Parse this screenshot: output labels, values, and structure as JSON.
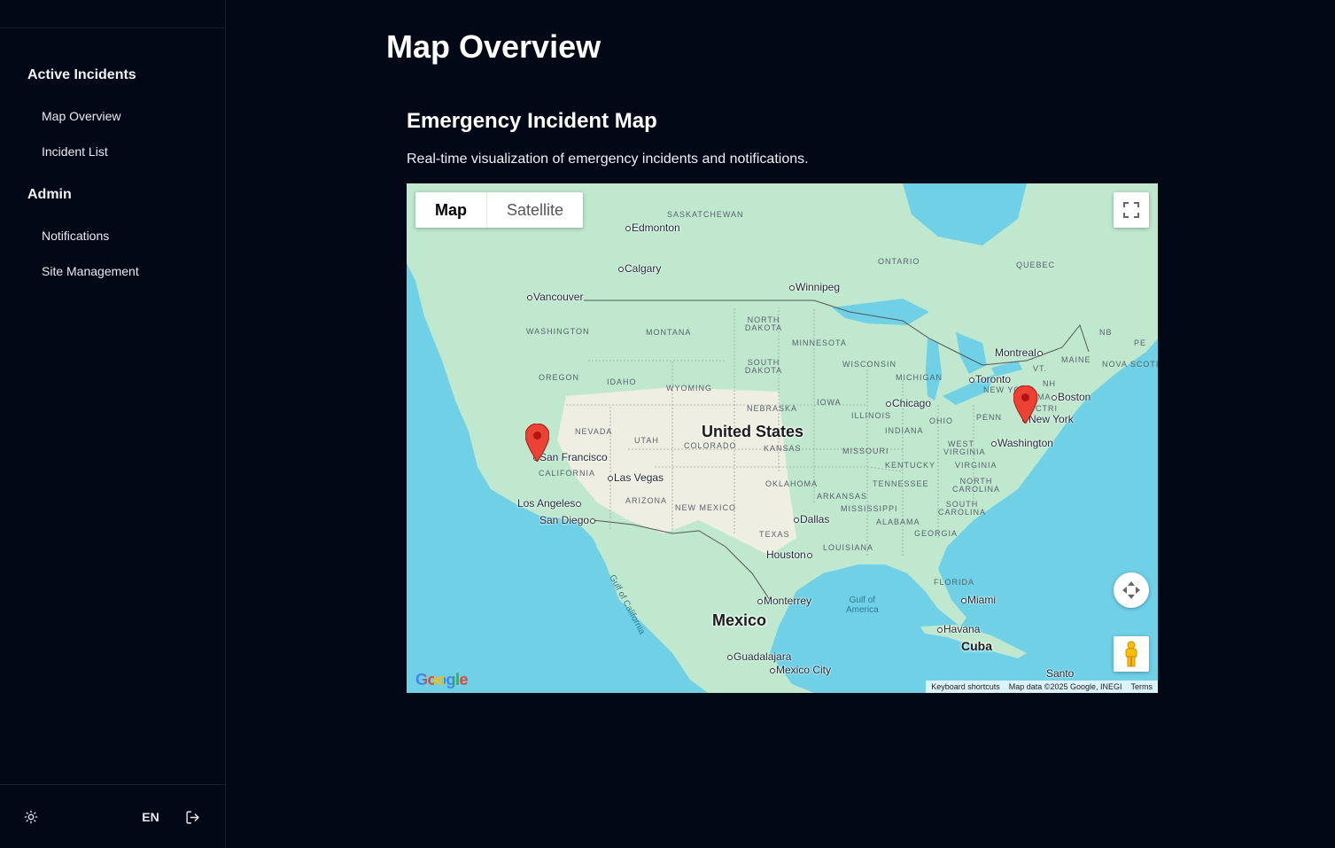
{
  "sidebar": {
    "groups": [
      {
        "title": "Active Incidents",
        "items": [
          "Map Overview",
          "Incident List"
        ]
      },
      {
        "title": "Admin",
        "items": [
          "Notifications",
          "Site Management"
        ]
      }
    ],
    "footer": {
      "theme_icon": "sun-icon",
      "language": "EN",
      "logout_icon": "logout-icon"
    }
  },
  "page": {
    "title": "Map Overview",
    "card_title": "Emergency Incident Map",
    "card_description": "Real-time visualization of emergency incidents and notifications."
  },
  "map": {
    "map_type_options": [
      "Map",
      "Satellite"
    ],
    "selected_map_type": "Map",
    "countries": [
      "United States",
      "Mexico",
      "Cuba"
    ],
    "regions": {
      "saskatchewan": "SASKATCHEWAN",
      "ontario": "ONTARIO",
      "quebec": "QUEBEC",
      "nb": "NB",
      "pe": "PE",
      "maine": "MAINE",
      "nova_scotia": "NOVA SCOTIA",
      "vt": "VT.",
      "nh": "NH",
      "ma": "MA",
      "ct": "CT",
      "ri": "RI",
      "washington": "WASHINGTON",
      "montana": "MONTANA",
      "north_dakota": "NORTH DAKOTA",
      "minnesota": "MINNESOTA",
      "oregon": "OREGON",
      "idaho": "IDAHO",
      "wyoming": "WYOMING",
      "south_dakota": "SOUTH DAKOTA",
      "wisconsin": "WISCONSIN",
      "michigan": "MICHIGAN",
      "new_york": "NEW YORK",
      "nebraska": "NEBRASKA",
      "iowa": "IOWA",
      "illinois": "ILLINOIS",
      "ohio": "OHIO",
      "penn": "PENN",
      "nevada": "NEVADA",
      "utah": "UTAH",
      "colorado": "COLORADO",
      "kansas": "KANSAS",
      "missouri": "MISSOURI",
      "indiana": "INDIANA",
      "west_virginia": "WEST VIRGINIA",
      "virginia": "VIRGINIA",
      "kentucky": "KENTUCKY",
      "california": "CALIFORNIA",
      "arizona": "ARIZONA",
      "new_mexico": "NEW MEXICO",
      "oklahoma": "OKLAHOMA",
      "arkansas": "ARKANSAS",
      "tennessee": "TENNESSEE",
      "north_carolina": "NORTH CAROLINA",
      "mississippi": "MISSISSIPPI",
      "alabama": "ALABAMA",
      "georgia": "GEORGIA",
      "south_carolina": "SOUTH CAROLINA",
      "texas": "TEXAS",
      "louisiana": "LOUISIANA",
      "florida": "FLORIDA"
    },
    "cities": {
      "edmonton": "Edmonton",
      "calgary": "Calgary",
      "winnipeg": "Winnipeg",
      "vancouver": "Vancouver",
      "montreal": "Montreal",
      "toronto": "Toronto",
      "boston": "Boston",
      "chicago": "Chicago",
      "new_york": "New York",
      "washington": "Washington",
      "san_francisco": "San Francisco",
      "las_vegas": "Las Vegas",
      "los_angeles": "Los Angeles",
      "san_diego": "San Diego",
      "dallas": "Dallas",
      "houston": "Houston",
      "monterrey": "Monterrey",
      "miami": "Miami",
      "havana": "Havana",
      "guadalajara": "Guadalajara",
      "mexico_city": "Mexico City",
      "santo": "Santo"
    },
    "waters": {
      "gulf_of_mexico": "Gulf of\nAmerica",
      "gulf_of_california": "Gulf of California"
    },
    "incident_markers": [
      "San Francisco",
      "New York"
    ],
    "marker_color": "#ea4335",
    "attribution": {
      "shortcuts": "Keyboard shortcuts",
      "data": "Map data ©2025 Google, INEGI",
      "terms": "Terms"
    },
    "logo": "Google"
  },
  "colors": {
    "background": "#030816",
    "water": "#6fd0e6",
    "land": "#bfe8cf",
    "desert": "#efeee2"
  }
}
